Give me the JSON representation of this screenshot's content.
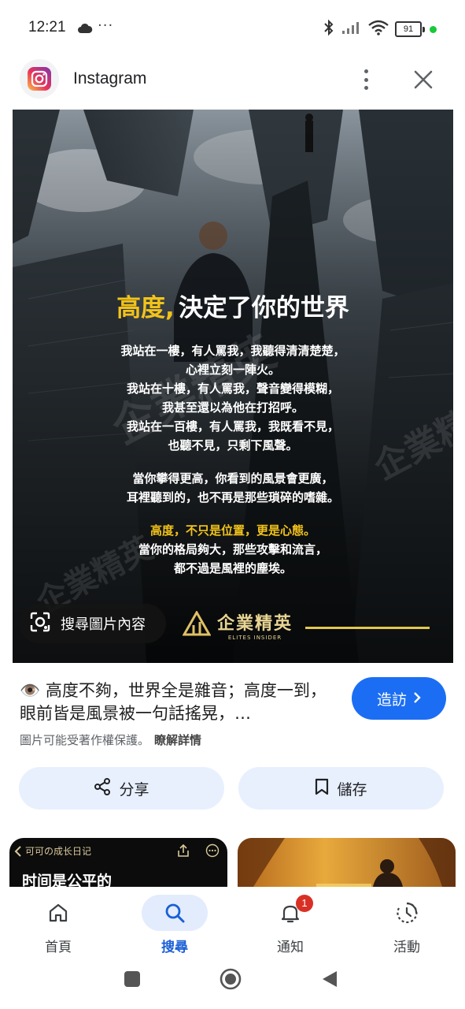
{
  "status_bar": {
    "time": "12:21",
    "overflow": "···",
    "battery": "91",
    "icons": [
      "cloud-icon",
      "bluetooth-icon",
      "signal-icon",
      "wifi-icon",
      "battery-icon"
    ]
  },
  "app_header": {
    "title": "Instagram"
  },
  "image": {
    "headline_part1": "高度,",
    "headline_part2": "決定了你的世界",
    "poem": [
      "我站在一樓，有人罵我，我聽得清清楚楚，",
      "心裡立刻一陣火。",
      "我站在十樓，有人罵我，聲音變得模糊，",
      "我甚至還以為他在打招呼。",
      "我站在一百樓，有人罵我，我既看不見，",
      "也聽不見，只剩下風聲。",
      "當你攀得更高，你看到的風景會更廣，",
      "耳裡聽到的，也不再是那些瑣碎的嗜雜。",
      "高度，不只是位置，更是心態。",
      "當你的格局夠大，那些攻擊和流言，",
      "都不過是風裡的塵埃。"
    ],
    "brand_name": "企業精英",
    "brand_sub": "ELITES INSIDER",
    "watermark": "企業精英",
    "lens_label": "搜尋圖片內容"
  },
  "result": {
    "description": "👁️ 高度不夠，世界全是雜音；高度一到，眼前皆是風景被一句話搖晃，…",
    "visit_label": "造訪",
    "copyright_text": "圖片可能受著作權保護。",
    "learn_more": "瞭解詳情",
    "share_label": "分享",
    "save_label": "儲存"
  },
  "related": {
    "left_header": "可可の成长日记",
    "left_title": "时间是公平的"
  },
  "bottom_nav": {
    "items": [
      {
        "label": "首頁",
        "icon": "home-icon"
      },
      {
        "label": "搜尋",
        "icon": "search-icon",
        "active": true
      },
      {
        "label": "通知",
        "icon": "bell-icon",
        "badge": "1"
      },
      {
        "label": "活動",
        "icon": "activity-icon"
      }
    ]
  },
  "colors": {
    "accent": "#1b6ef3",
    "chip_bg": "#e8f0fe",
    "headline_yellow": "#f2c31a",
    "badge_red": "#d93025"
  }
}
